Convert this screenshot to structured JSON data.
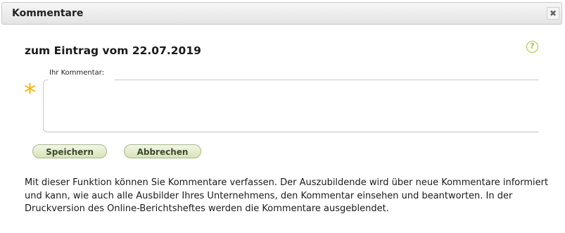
{
  "dialog": {
    "title": "Kommentare",
    "close_icon": "close-icon"
  },
  "entry": {
    "heading": "zum Eintrag vom 22.07.2019"
  },
  "help": {
    "icon": "question-circle-icon",
    "glyph": "?"
  },
  "comment": {
    "label": "Ihr Kommentar:",
    "value": "",
    "required_marker": "*",
    "required_color": "#f2b400"
  },
  "buttons": {
    "save_label": "Speichern",
    "cancel_label": "Abbrechen"
  },
  "info_text": "Mit dieser Funktion können Sie Kommentare verfassen. Der Auszubildende wird über neue Kommentare informiert und kann, wie auch alle Ausbilder Ihres Unternehmens, den Kommentar einsehen und beantworten. In der Druckversion des Online-Berichtsheftes werden die Kommentare ausgeblendet."
}
